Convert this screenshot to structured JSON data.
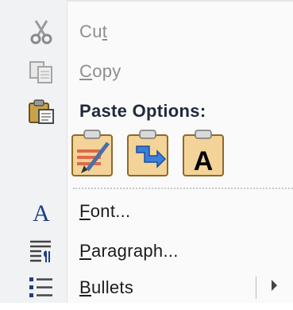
{
  "menu": {
    "cut": {
      "pre": "Cu",
      "key": "t",
      "post": "",
      "icon": "scissors-icon"
    },
    "copy": {
      "pre": "",
      "key": "C",
      "post": "opy",
      "icon": "copy-icon"
    },
    "paste_options": {
      "label": "Paste Options:",
      "icon": "clipboard-icon"
    },
    "paste_buttons": [
      {
        "name": "keep-source-formatting",
        "icon": "paste-keep-formatting-icon"
      },
      {
        "name": "merge-formatting",
        "icon": "paste-merge-formatting-icon"
      },
      {
        "name": "keep-text-only",
        "icon": "paste-text-only-icon",
        "glyph": "A"
      }
    ],
    "font": {
      "pre": "",
      "key": "F",
      "post": "ont...",
      "icon": "font-icon",
      "glyph": "A"
    },
    "paragraph": {
      "pre": "",
      "key": "P",
      "post": "aragraph...",
      "icon": "paragraph-icon"
    },
    "bullets": {
      "pre": "",
      "key": "B",
      "post": "ullets",
      "icon": "bullets-icon"
    }
  },
  "colors": {
    "accent": "#2e6fd0",
    "disabled_text": "#8e8e8e",
    "clipboard": "#f1d39a"
  }
}
